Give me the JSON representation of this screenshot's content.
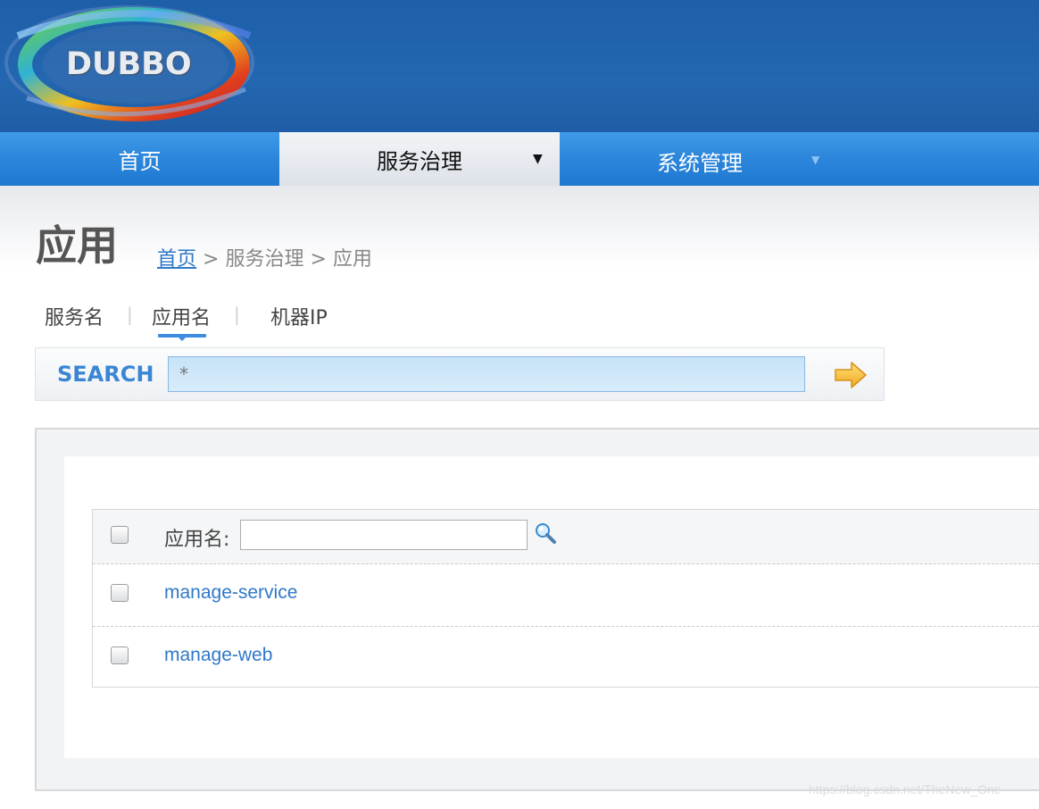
{
  "header": {
    "logo_text": "DUBBO"
  },
  "nav": {
    "items": [
      {
        "label": "首页",
        "active": false
      },
      {
        "label": "服务治理",
        "active": true
      },
      {
        "label": "系统管理",
        "active": false
      }
    ]
  },
  "page": {
    "title": "应用",
    "breadcrumb": {
      "home": "首页",
      "sep1": ">",
      "section": "服务治理",
      "sep2": ">",
      "current": "应用"
    }
  },
  "tabs": [
    {
      "label": "服务名",
      "active": false
    },
    {
      "label": "应用名",
      "active": true
    },
    {
      "label": "机器IP",
      "active": false
    }
  ],
  "search": {
    "label": "SEARCH",
    "value": "*"
  },
  "table": {
    "column_label": "应用名:",
    "filter_value": "",
    "rows": [
      {
        "name": "manage-service"
      },
      {
        "name": "manage-web"
      }
    ]
  },
  "colors": {
    "header_blue": "#2367b0",
    "nav_blue": "#2b86dc",
    "link_blue": "#2f78c8",
    "search_label": "#3a86d4"
  },
  "watermark": "https://blog.csdn.net/TheNew_One"
}
